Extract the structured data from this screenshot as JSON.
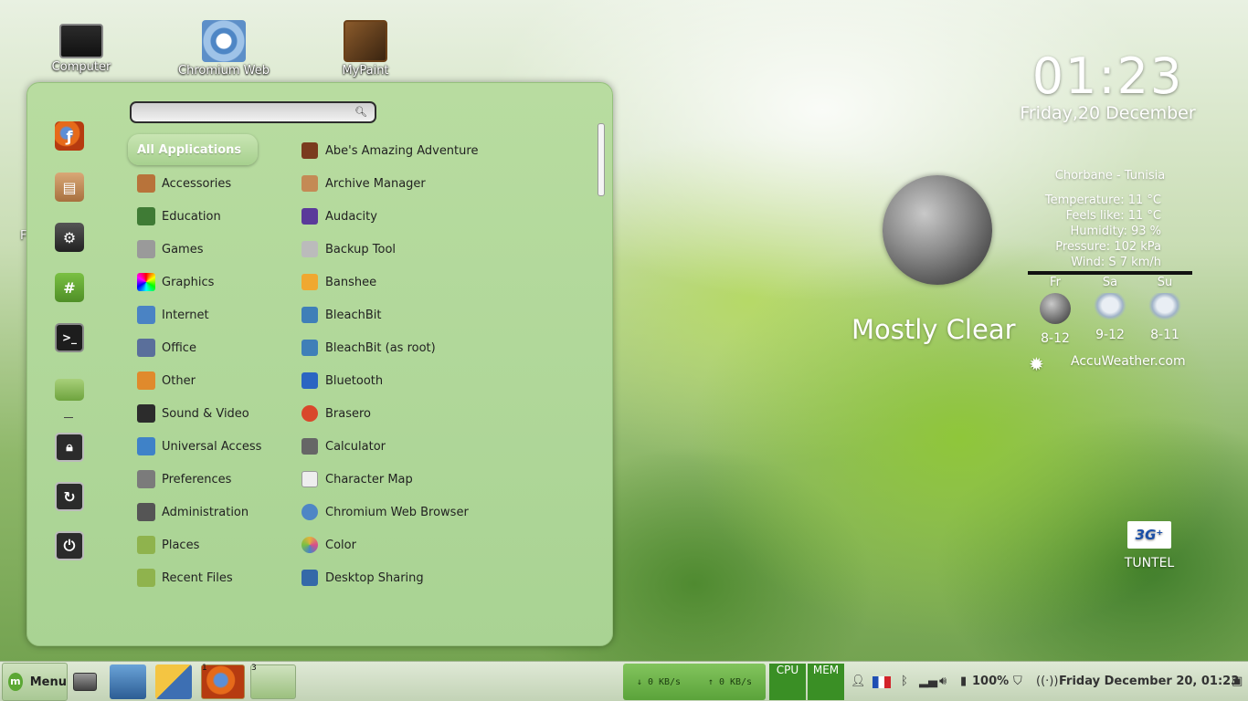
{
  "desktop": {
    "icons": [
      {
        "label": "Computer",
        "icon": "computer-icon"
      },
      {
        "label": "Chromium Web",
        "icon": "chromium-icon"
      },
      {
        "label": "MyPaint",
        "icon": "mypaint-icon"
      }
    ],
    "partial_label": "F"
  },
  "menu": {
    "search": {
      "value": "",
      "placeholder": ""
    },
    "favorites": [
      "firefox-icon",
      "archive-icon",
      "settings-icon",
      "terminal-hash-icon",
      "terminal-icon",
      "folder-icon",
      "lock-icon",
      "logout-icon",
      "power-icon"
    ],
    "categories": [
      {
        "label": "All Applications",
        "active": true,
        "color": ""
      },
      {
        "label": "Accessories",
        "color": "#b8733a"
      },
      {
        "label": "Education",
        "color": "#3f7b35"
      },
      {
        "label": "Games",
        "color": "#9a9a9a"
      },
      {
        "label": "Graphics",
        "color": "#d94d8b"
      },
      {
        "label": "Internet",
        "color": "#4a83c4"
      },
      {
        "label": "Office",
        "color": "#5a6f9b"
      },
      {
        "label": "Other",
        "color": "#e08a2c"
      },
      {
        "label": "Sound & Video",
        "color": "#2c2c2c"
      },
      {
        "label": "Universal Access",
        "color": "#3f82c8"
      },
      {
        "label": "Preferences",
        "color": "#7b7b7b"
      },
      {
        "label": "Administration",
        "color": "#555555"
      },
      {
        "label": "Places",
        "color": "#8fb34d"
      },
      {
        "label": "Recent Files",
        "color": "#8fb34d"
      }
    ],
    "apps": [
      {
        "label": "Abe's Amazing Adventure",
        "color": "#7a3b1e"
      },
      {
        "label": "Archive Manager",
        "color": "#c48a55"
      },
      {
        "label": "Audacity",
        "color": "#5a3a9a"
      },
      {
        "label": "Backup Tool",
        "color": "#bbbbbb"
      },
      {
        "label": "Banshee",
        "color": "#f0a830"
      },
      {
        "label": "BleachBit",
        "color": "#3f7fb8"
      },
      {
        "label": "BleachBit (as root)",
        "color": "#3f7fb8"
      },
      {
        "label": "Bluetooth",
        "color": "#2b65c2"
      },
      {
        "label": "Brasero",
        "color": "#d9472b"
      },
      {
        "label": "Calculator",
        "color": "#666666"
      },
      {
        "label": "Character Map",
        "color": "#eeeeee"
      },
      {
        "label": "Chromium Web Browser",
        "color": "#4e86c5"
      },
      {
        "label": "Color",
        "color": "#e3b23c"
      },
      {
        "label": "Desktop Sharing",
        "color": "#3469a8"
      }
    ]
  },
  "clock": {
    "time": "01:23",
    "date": "Friday,20 December"
  },
  "weather": {
    "location": "Chorbane - Tunisia",
    "details": [
      "Temperature: 11 °C",
      "Feels like: 11 °C",
      "Humidity: 93 %",
      "Pressure: 102 kPa",
      "Wind: S 7 km/h"
    ],
    "condition": "Mostly Clear",
    "forecast": [
      {
        "day": "Fr",
        "range": "8-12",
        "icon": "moon-icon"
      },
      {
        "day": "Sa",
        "range": "9-12",
        "icon": "cloud-icon"
      },
      {
        "day": "Su",
        "range": "8-11",
        "icon": "rain-cloud-icon"
      }
    ],
    "provider": "AccuWeather.com"
  },
  "tuntel": {
    "logo": "3G⁺",
    "label": "TUNTEL"
  },
  "taskbar": {
    "menu_label": "Menu",
    "workspace_numbers": [
      "1",
      "3"
    ],
    "net_down": "↓ 0 KB/s",
    "net_up": "↑ 0 KB/s",
    "cpu_label": "CPU",
    "mem_label": "MEM",
    "battery": "100%",
    "datetime": "Friday December 20, 01:23"
  }
}
